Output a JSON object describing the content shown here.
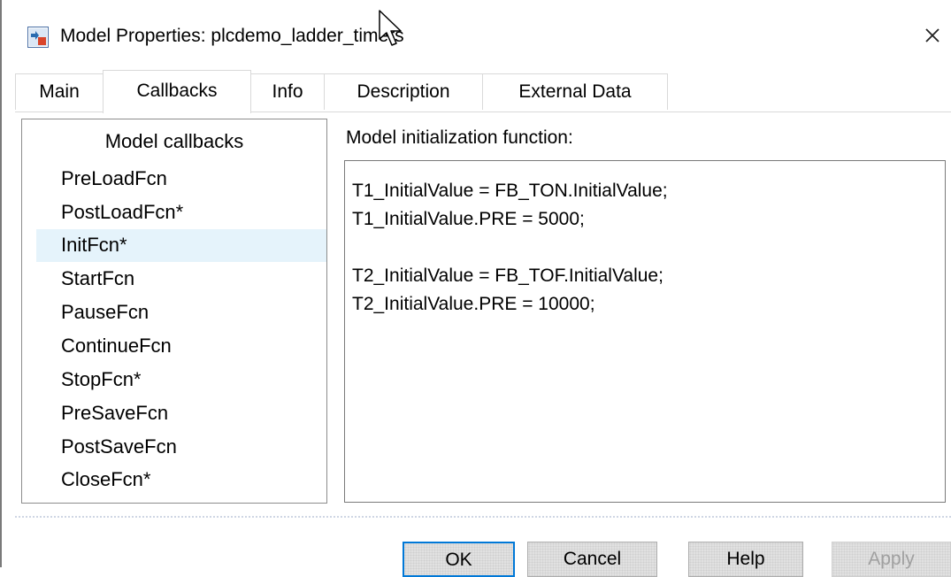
{
  "window": {
    "title": "Model Properties: plcdemo_ladder_timers",
    "close_glyph": "×"
  },
  "tabs": [
    {
      "label": "Main"
    },
    {
      "label": "Callbacks",
      "active": true
    },
    {
      "label": "Info"
    },
    {
      "label": "Description"
    },
    {
      "label": "External Data"
    }
  ],
  "callbacks": {
    "heading": "Model callbacks",
    "selected": "InitFcn*",
    "items": [
      "PreLoadFcn",
      "PostLoadFcn*",
      "InitFcn*",
      "StartFcn",
      "PauseFcn",
      "ContinueFcn",
      "StopFcn*",
      "PreSaveFcn",
      "PostSaveFcn",
      "CloseFcn*"
    ]
  },
  "editor": {
    "label": "Model initialization function:",
    "lines": [
      "T1_InitialValue = FB_TON.InitialValue;",
      "T1_InitialValue.PRE = 5000;",
      "",
      "T2_InitialValue = FB_TOF.InitialValue;",
      "T2_InitialValue.PRE = 10000;"
    ]
  },
  "buttons": {
    "ok": "OK",
    "cancel": "Cancel",
    "help": "Help",
    "apply": "Apply"
  },
  "colors": {
    "selection_bg": "#e5f3fb",
    "default_button_border": "#0078d7",
    "disabled_text": "#a0a0a0"
  },
  "icons": {
    "app": "simulink-model-icon",
    "close": "close-icon",
    "cursor": "mouse-pointer-icon"
  }
}
